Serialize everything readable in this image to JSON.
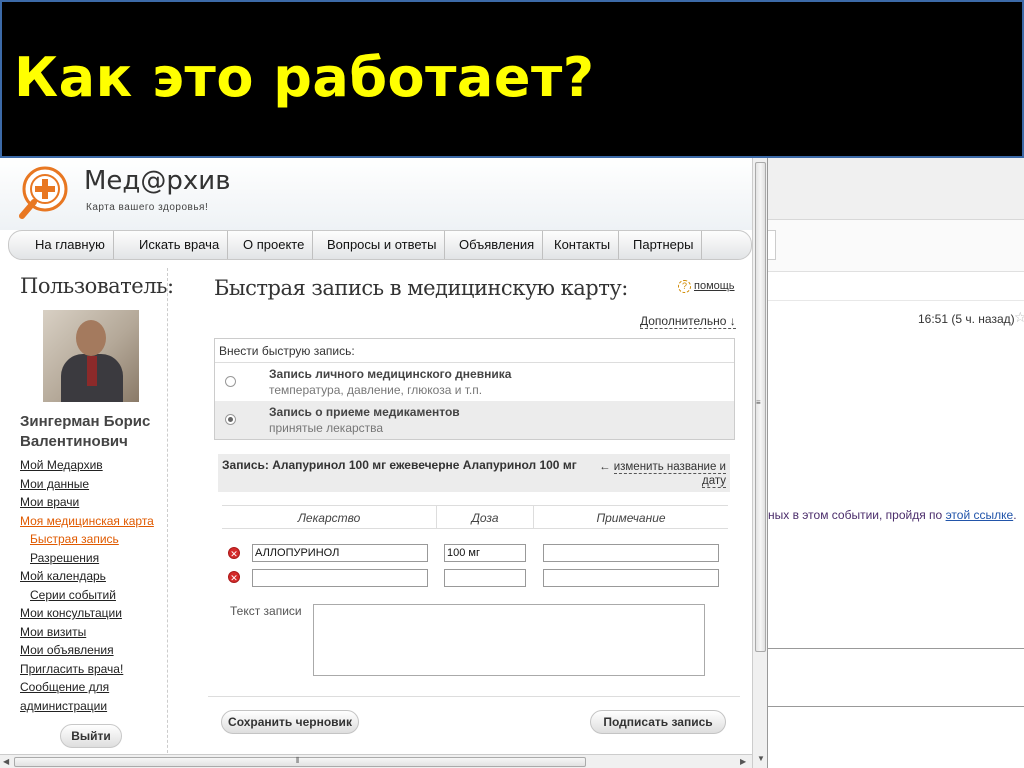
{
  "slide": {
    "title": "Как это работает?"
  },
  "site": {
    "name": "Мед@рхив",
    "tagline": "Карта вашего здоровья!"
  },
  "nav": [
    "На главную",
    "Искать врача",
    "О проекте",
    "Вопросы и ответы",
    "Объявления",
    "Контакты",
    "Партнеры"
  ],
  "sidebar": {
    "heading": "Пользователь:",
    "user_name": "Зингерман Борис Валентинович",
    "menu": [
      {
        "label": "Мой Медархив"
      },
      {
        "label": "Мои данные"
      },
      {
        "label": "Мои врачи"
      },
      {
        "label": "Моя медицинская карта",
        "active": true
      },
      {
        "label": "Быстрая запись",
        "sub": true,
        "active": true
      },
      {
        "label": "Разрешения",
        "sub": true
      },
      {
        "label": "Мой календарь"
      },
      {
        "label": "Серии событий",
        "sub": true
      },
      {
        "label": "Мои консультации"
      },
      {
        "label": "Мои визиты"
      },
      {
        "label": "Мои объявления"
      },
      {
        "label": "Пригласить врача!"
      },
      {
        "label": "Сообщение для администрации"
      }
    ],
    "logout": "Выйти"
  },
  "main": {
    "title": "Быстрая запись в медицинскую карту:",
    "help": "помощь",
    "more": "Дополнительно ↓",
    "quick_box": {
      "header": "Внести быструю запись:",
      "options": [
        {
          "title": "Запись личного медицинского дневника",
          "desc": "температура, давление, глюкоза и т.п.",
          "selected": false
        },
        {
          "title": "Запись о приеме медикаментов",
          "desc": "принятые лекарства",
          "selected": true
        }
      ]
    },
    "entry": {
      "text": "Запись: Алапуринол 100 мг ежевечерне Алапуринол 100 мг",
      "change_arrow": "←",
      "change_link": "изменить название и дату"
    },
    "table": {
      "headers": [
        "Лекарство",
        "Доза",
        "Примечание"
      ],
      "rows": [
        {
          "drug": "АЛЛОПУРИНОЛ",
          "dose": "100 мг",
          "note": ""
        },
        {
          "drug": "",
          "dose": "",
          "note": ""
        }
      ]
    },
    "notes_label": "Текст записи",
    "save_draft": "Сохранить черновик",
    "sign": "Подписать запись"
  },
  "background_window": {
    "time": "16:51 (5 ч. назад)",
    "message_prefix": "ных в этом событии, пройдя по",
    "message_link": "этой ссылке",
    "message_suffix": "."
  }
}
